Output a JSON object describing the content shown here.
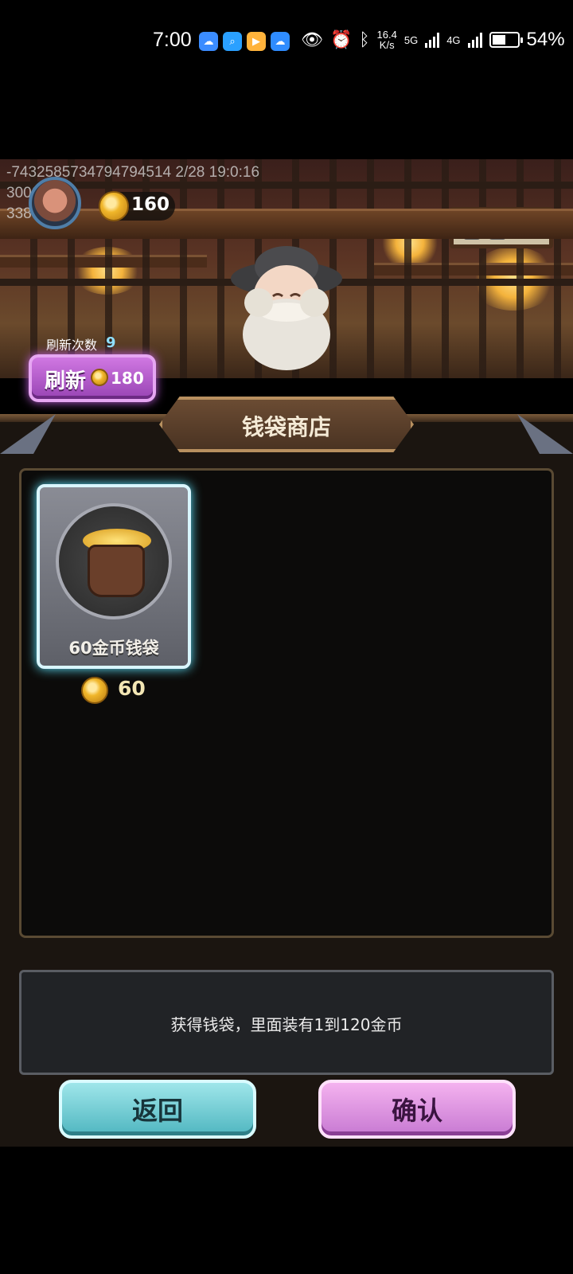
{
  "status_bar": {
    "time": "7:00",
    "net_speed_value": "16.4",
    "net_speed_unit": "K/s",
    "signal1_label": "5G",
    "signal2_label": "4G",
    "battery_percent": "54%",
    "battery_level": 0.54
  },
  "debug": {
    "line1": "-7432585734794794514 2/28 19:0:16",
    "line2": "3000",
    "line3": "3388"
  },
  "player": {
    "coins": "160"
  },
  "refresh": {
    "count_label": "刷新次数",
    "count": "9",
    "button_label": "刷新",
    "cost": "180"
  },
  "shop": {
    "title": "钱袋商店",
    "items": [
      {
        "name": "60金币钱袋",
        "price": "60"
      }
    ],
    "description": "获得钱袋，里面装有1到120金币"
  },
  "actions": {
    "back_label": "返回",
    "confirm_label": "确认"
  }
}
